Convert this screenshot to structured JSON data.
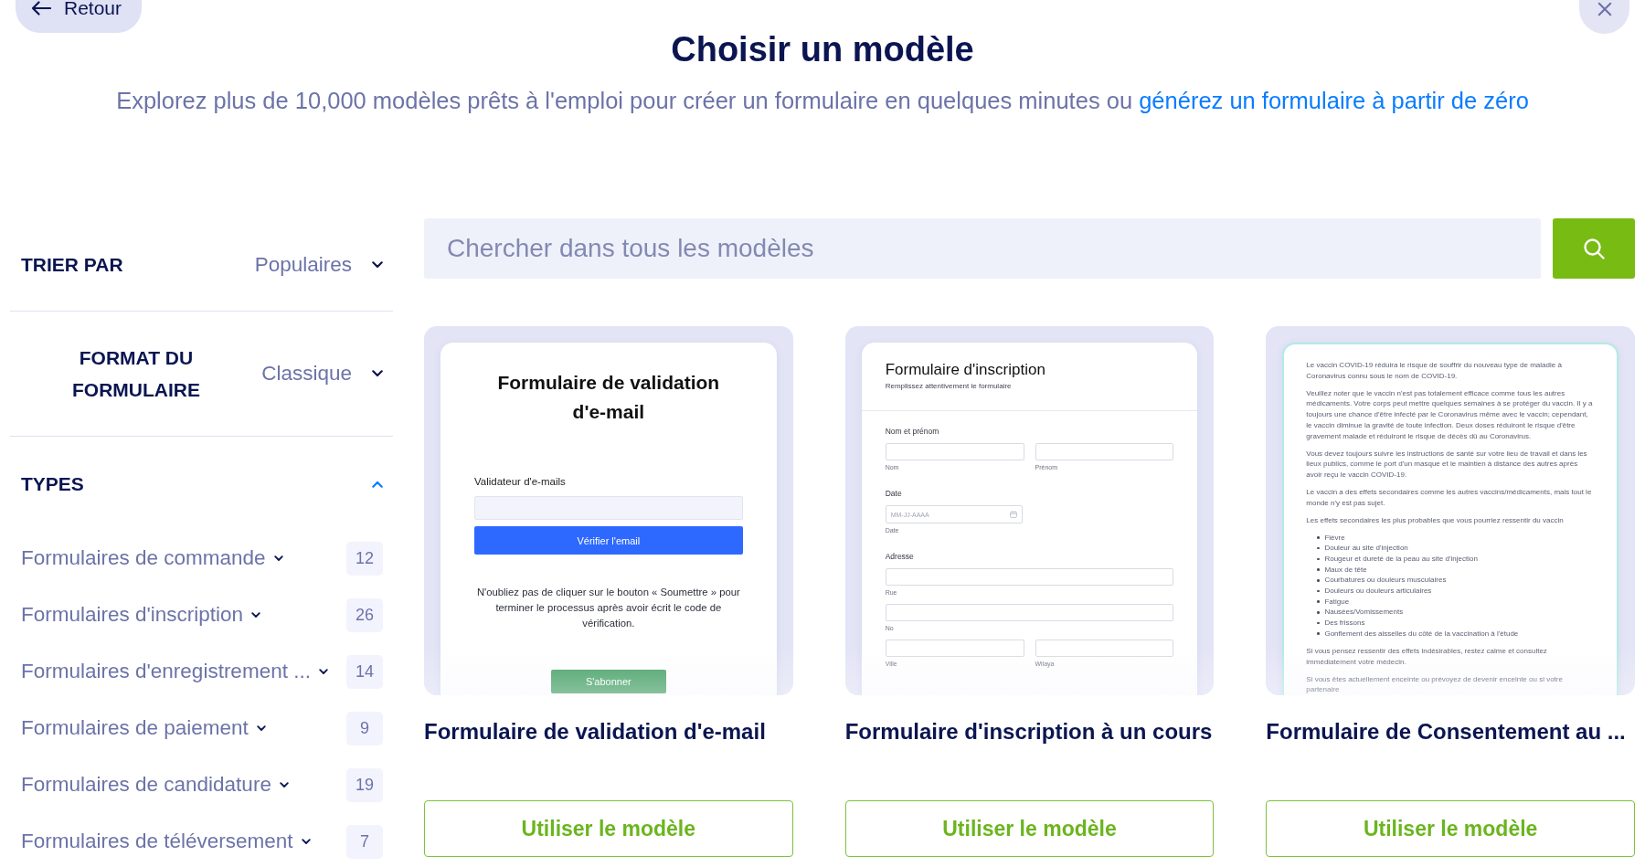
{
  "header": {
    "back_button": {
      "label": "Retour"
    },
    "title": "Choisir un modèle",
    "subtitle": {
      "text": "Explorez plus de 10,000 modèles prêts à l'emploi pour créer un formulaire en quelques minutes ou",
      "link": "générez un formulaire à partir de zéro"
    }
  },
  "sidebar": {
    "sort": {
      "label": "TRIER PAR",
      "value": "Populaires"
    },
    "format": {
      "label": "FORMAT DU FORMULAIRE",
      "value": "Classique"
    },
    "types": {
      "label": "TYPES",
      "expanded": true,
      "items": [
        {
          "label": "Formulaires de commande",
          "count": "12"
        },
        {
          "label": "Formulaires d'inscription",
          "count": "26"
        },
        {
          "label": "Formulaires d'enregistrement ...",
          "count": "14"
        },
        {
          "label": "Formulaires de paiement",
          "count": "9"
        },
        {
          "label": "Formulaires de candidature",
          "count": "19"
        },
        {
          "label": "Formulaires de téléversement",
          "count": "7"
        }
      ]
    }
  },
  "search": {
    "placeholder": "Chercher dans tous les modèles"
  },
  "templates": [
    {
      "title": "Formulaire de validation d'e-mail",
      "button": "Utiliser le modèle",
      "preview": {
        "kind": "centered",
        "heading": "Formulaire de validation d'e-mail",
        "field_label": "Validateur d'e-mails",
        "action": "Vérifier l'email",
        "note": "N'oubliez pas de cliquer sur le bouton « Soumettre » pour terminer le processus après avoir écrit le code de vérification.",
        "submit": "S'abonner"
      }
    },
    {
      "title": "Formulaire d'inscription à un cours",
      "button": "Utiliser le modèle",
      "preview": {
        "kind": "fields",
        "heading": "Formulaire d'inscription",
        "subheading": "Remplissez attentivement le formulaire",
        "fields": [
          {
            "label": "Nom et prénom",
            "inputs": [
              {
                "kind": "text",
                "sublabel": "Nom"
              },
              {
                "kind": "text",
                "sublabel": "Prénom"
              }
            ]
          },
          {
            "label": "Date",
            "inputs": [
              {
                "kind": "date",
                "placeholder": "MM-JJ-AAAA",
                "sublabel": "Date"
              }
            ]
          },
          {
            "label": "Adresse",
            "inputs": [
              {
                "kind": "text",
                "sublabel": "Rue"
              }
            ]
          },
          {
            "inputs": [
              {
                "kind": "text",
                "sublabel": "No"
              }
            ]
          },
          {
            "inputs": [
              {
                "kind": "text",
                "sublabel": "Ville"
              },
              {
                "kind": "text",
                "sublabel": "Wilaya"
              }
            ]
          }
        ]
      }
    },
    {
      "title": "Formulaire de Consentement au ...",
      "button": "Utiliser le modèle",
      "preview": {
        "kind": "text",
        "blocks": [
          {
            "kind": "paragraph",
            "text": "Le vaccin COVID-19 réduira le risque de souffrir du nouveau type de maladie à Coronavirus connu sous le nom de COVID-19."
          },
          {
            "kind": "paragraph",
            "text": "Veuillez noter que le vaccin n'est pas totalement efficace comme tous les autres médicaments. Votre corps peut mettre quelques semaines à se protéger du vaccin. Il y a toujours une chance d'être infecté par le Coronavirus même avec le vaccin; cependant, le vaccin diminue la gravité de toute infection. Deux doses réduiront le risque d'être gravement malade et réduiront le risque de décès dû au Coronavirus."
          },
          {
            "kind": "paragraph",
            "text": "Vous devez toujours suivre les instructions de santé sur votre lieu de travail et dans les lieux publics, comme le port d'un masque et le maintien à distance des autres après avoir reçu le vaccin COVID-19."
          },
          {
            "kind": "paragraph",
            "text": "Le vaccin a des effets secondaires comme les autres vaccins/médicaments, mais tout le monde n'y est pas sujet."
          },
          {
            "kind": "paragraph",
            "text": "Les effets secondaires les plus probables que vous pourriez ressentir du vaccin"
          },
          {
            "kind": "list",
            "items": [
              "Fièvre",
              "Douleur au site d'injection",
              "Rougeur et dureté de la peau au site d'injection",
              "Maux de tête",
              "Courbatures ou douleurs musculaires",
              "Douleurs ou douleurs articulaires",
              "Fatigue",
              "Nausées/Vomissements",
              "Des frissons",
              "Gonflement des aisselles du côté de la vaccination à l'étude"
            ]
          },
          {
            "kind": "paragraph",
            "text": "Si vous pensez ressentir des effets indésirables, restez calme et consultez immédiatement votre médecin."
          },
          {
            "kind": "paragraph",
            "text": "Si vous êtes actuellement enceinte ou prévoyez de devenir enceinte ou si votre partenaire"
          }
        ]
      }
    }
  ]
}
